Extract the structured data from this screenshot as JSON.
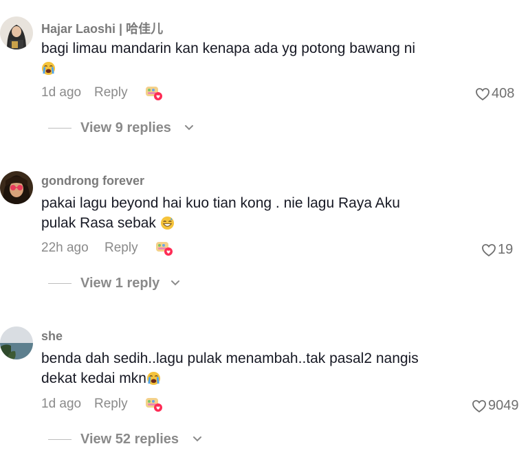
{
  "comments": [
    {
      "username": "Hajar Laoshi | 哈佳儿",
      "text": "bagi limau mandarin kan kenapa ada yg potong bawang ni",
      "emoji": "loudly-crying-face",
      "time": "1d ago",
      "reply_label": "Reply",
      "likes": "408",
      "view_replies": "View 9 replies"
    },
    {
      "username": "gondrong forever",
      "text_line1": "pakai lagu beyond hai kuo tian kong . nie lagu Raya Aku",
      "text_line2": "pulak Rasa sebak",
      "emoji": "grinning-face-with-sweat",
      "time": "22h ago",
      "reply_label": "Reply",
      "likes": "19",
      "view_replies": "View 1 reply"
    },
    {
      "username": "she",
      "text_line1": "benda dah sedih..lagu pulak menambah..tak pasal2 nangis",
      "text_line2": "dekat kedai mkn",
      "emoji": "loudly-crying-face",
      "time": "1d ago",
      "reply_label": "Reply",
      "likes": "9049",
      "view_replies": "View 52 replies"
    }
  ],
  "icons": {
    "like": "heart-outline-icon",
    "reaction": "reaction-sticker-icon",
    "expand": "chevron-down-icon"
  },
  "colors": {
    "text": "#161823",
    "muted": "#8a8a8a",
    "reaction_heart": "#fe2c55"
  }
}
